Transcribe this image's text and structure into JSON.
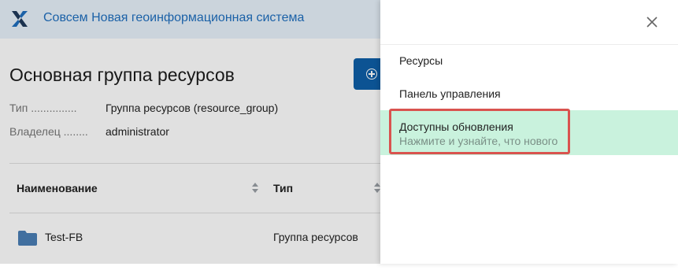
{
  "header": {
    "logo_icon": "x-logo-icon",
    "app_title": "Совсем Новая геоинформационная система"
  },
  "resource": {
    "title": "Основная группа ресурсов",
    "create_button_icon": "plus-circle-icon",
    "meta": [
      {
        "key": "Тип ...............",
        "value": "Группа ресурсов (resource_group)"
      },
      {
        "key": "Владелец ........",
        "value": "administrator"
      }
    ]
  },
  "table": {
    "columns": [
      "Наименование",
      "Тип"
    ],
    "rows": [
      {
        "name": "Test-FB",
        "type": "Группа ресурсов",
        "icon": "folder-icon"
      }
    ]
  },
  "drawer": {
    "close_icon": "close-icon",
    "items": [
      {
        "label": "Ресурсы"
      },
      {
        "label": "Панель управления"
      },
      {
        "label": "Доступны обновления",
        "sublabel": "Нажмите и узнайте, что нового"
      }
    ]
  },
  "colors": {
    "accent": "#1f6fbf",
    "primary_button": "#0e5fa8",
    "update_item_bg": "#c9f2dd",
    "highlight": "#d9534f"
  }
}
